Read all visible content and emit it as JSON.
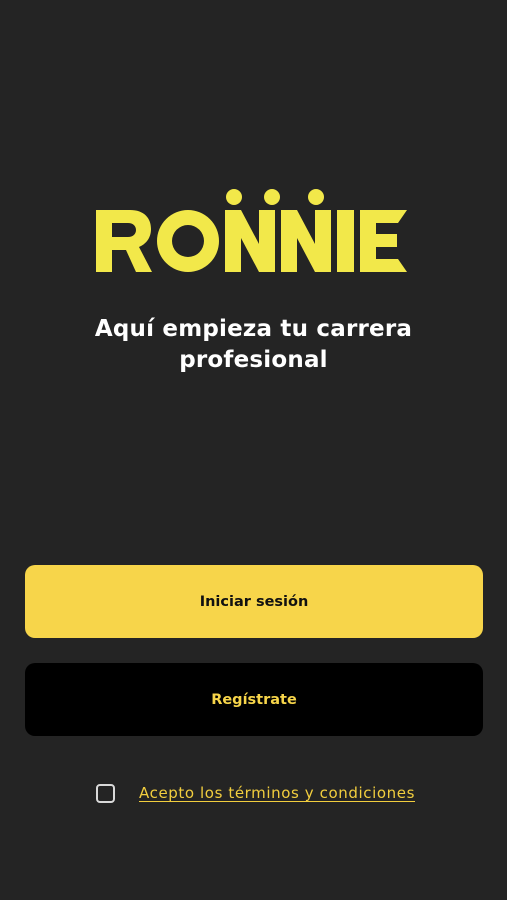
{
  "app": {
    "logo_text": "RONNIE",
    "brand_color": "#f2e84a"
  },
  "welcome": {
    "tagline_line1": "Aquí empieza tu carrera",
    "tagline_line2": "profesional"
  },
  "actions": {
    "login_label": "Iniciar sesión",
    "register_label": "Regístrate"
  },
  "terms": {
    "checked": false,
    "label": "Acepto los términos y condiciones"
  },
  "colors": {
    "background": "#242424",
    "primary_button": "#f7d54a",
    "secondary_button": "#000000",
    "link": "#f2ce3e"
  }
}
